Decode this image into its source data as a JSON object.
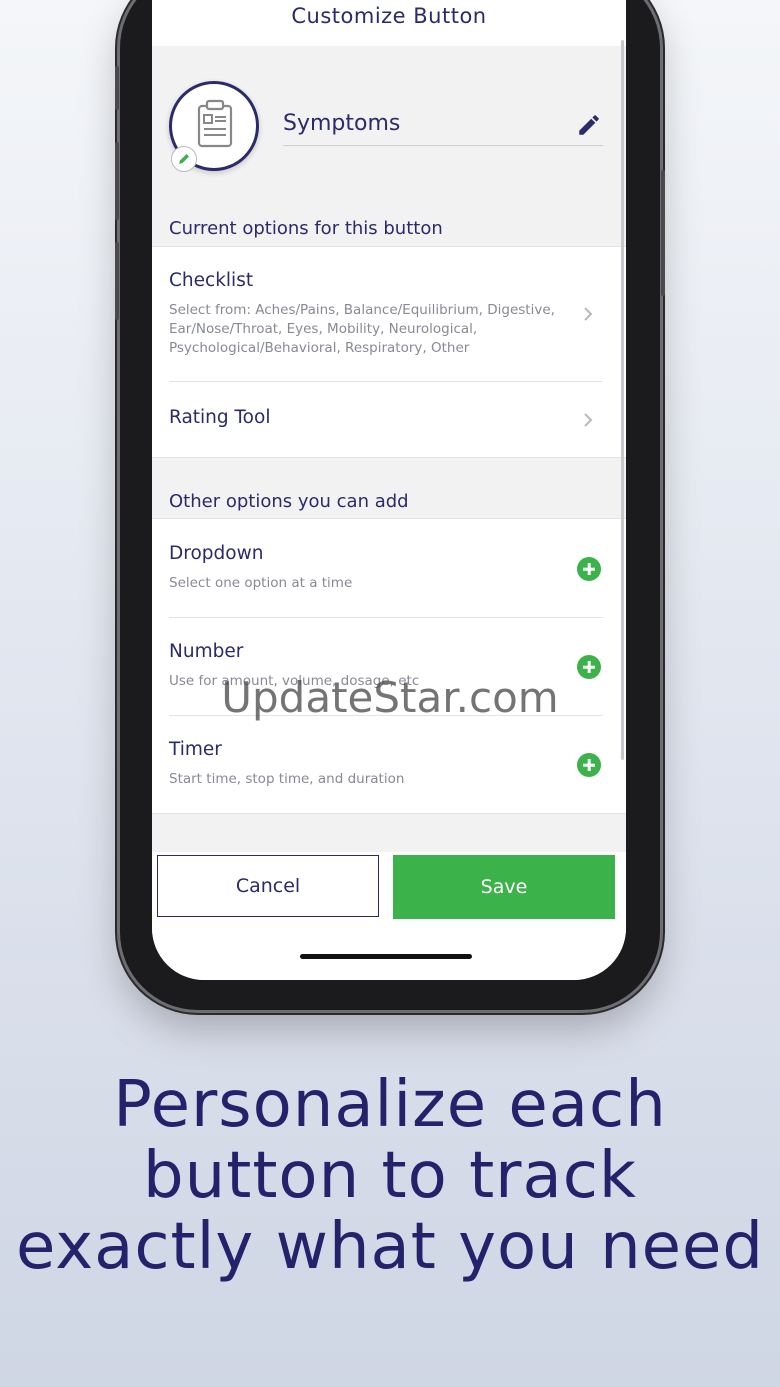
{
  "topbar": {
    "title": "Customize Button"
  },
  "button": {
    "name": "Symptoms"
  },
  "current_section": {
    "header": "Current options for this button",
    "items": [
      {
        "title": "Checklist",
        "desc": "Select from: Aches/Pains, Balance/Equilibrium, Digestive, Ear/Nose/Throat, Eyes, Mobility, Neurological, Psychological/Behavioral, Respiratory, Other"
      },
      {
        "title": "Rating Tool",
        "desc": ""
      }
    ]
  },
  "other_section": {
    "header": "Other options you can add",
    "items": [
      {
        "title": "Dropdown",
        "desc": "Select one option at a time"
      },
      {
        "title": "Number",
        "desc": "Use for amount, volume, dosage, etc"
      },
      {
        "title": "Timer",
        "desc": "Start time, stop time, and duration"
      }
    ]
  },
  "actions": {
    "cancel": "Cancel",
    "save": "Save"
  },
  "watermark": "UpdateStar.com",
  "headline": [
    "Personalize each",
    "button to track",
    "exactly what you need"
  ],
  "colors": {
    "brand_navy": "#2b2a6b",
    "accent_green": "#3cb24a"
  }
}
